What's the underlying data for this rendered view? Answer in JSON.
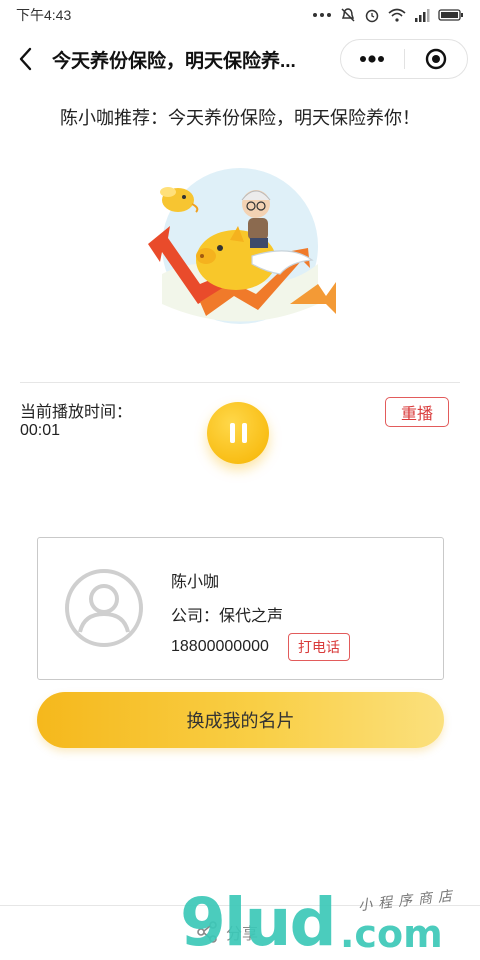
{
  "status_bar": {
    "time": "下午4:43"
  },
  "nav": {
    "title": "今天养份保险，明天保险养..."
  },
  "headline": "陈小咖推荐：今天养份保险，明天保险养你！",
  "player": {
    "label": "当前播放时间：",
    "time": "00:01",
    "replay_label": "重播",
    "state": "playing"
  },
  "card": {
    "name": "陈小咖",
    "company": "公司：保代之声",
    "phone": "18800000000",
    "call_label": "打电话"
  },
  "switch_button": "换成我的名片",
  "footer": {
    "share_label": "分享"
  },
  "watermark": {
    "brand": "9lud",
    "suffix": ".com",
    "tagline": "小程序商店"
  },
  "colors": {
    "accent_yellow": "#f6b300",
    "accent_red": "#d93b3b",
    "watermark_teal": "#3cc8b8"
  }
}
